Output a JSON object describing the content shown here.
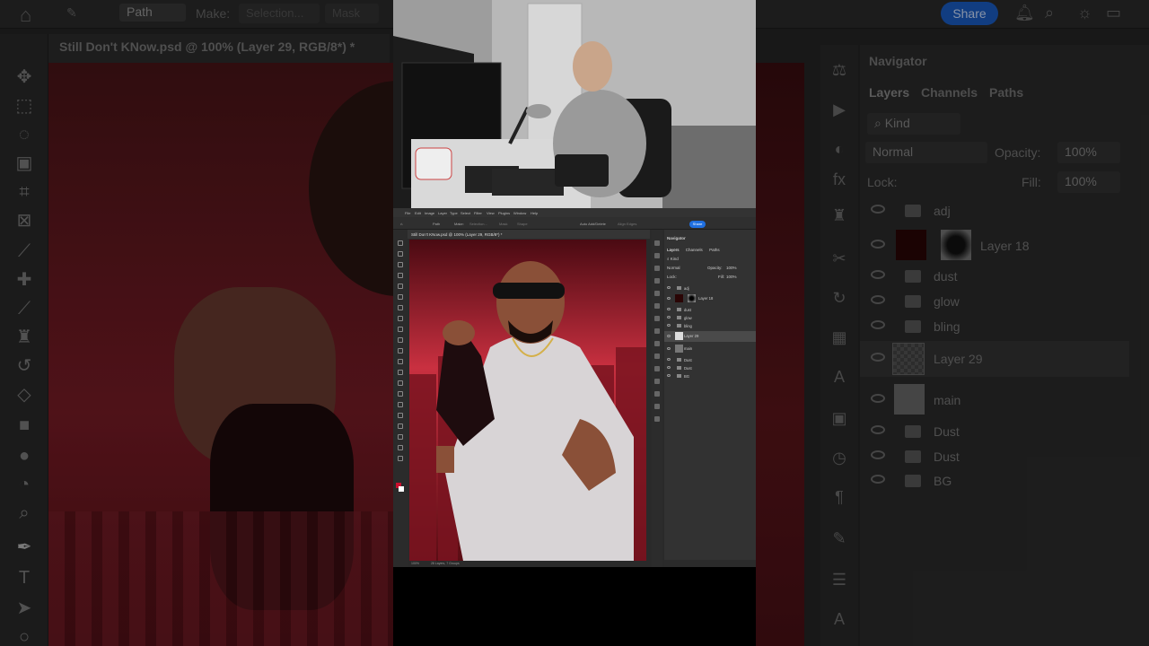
{
  "background_app": {
    "options_bar": {
      "path_mode": "Path",
      "make_label": "Make:",
      "selection_label": "Selection...",
      "mask_label": "Mask",
      "share_label": "Share"
    },
    "document_tab": "Still Don't KNow.psd @ 100% (Layer 29, RGB/8*) *",
    "panel": {
      "navigator_title": "Navigator",
      "tabs": [
        "Layers",
        "Channels",
        "Paths"
      ],
      "filter_kind": "Kind",
      "blend_mode": "Normal",
      "opacity_label": "Opacity:",
      "opacity_value": "100%",
      "lock_label": "Lock:",
      "fill_label": "Fill:",
      "fill_value": "100%",
      "layers": [
        {
          "name": "adj",
          "type": "group"
        },
        {
          "name": "Layer 18",
          "type": "layer-mask"
        },
        {
          "name": "dust",
          "type": "group"
        },
        {
          "name": "glow",
          "type": "group"
        },
        {
          "name": "bling",
          "type": "group"
        },
        {
          "name": "Layer 29",
          "type": "layer",
          "selected": true
        },
        {
          "name": "main",
          "type": "layer"
        },
        {
          "name": "Dust",
          "type": "group"
        },
        {
          "name": "Dust",
          "type": "group"
        },
        {
          "name": "BG",
          "type": "group"
        }
      ]
    }
  },
  "mini_app": {
    "menu": [
      "File",
      "Edit",
      "Image",
      "Layer",
      "Type",
      "Select",
      "Filter",
      "View",
      "Plugins",
      "Window",
      "Help"
    ],
    "options": [
      "Path",
      "Make:",
      "Selection...",
      "Mask",
      "Shape",
      "Auto Add/Delete",
      "Align Edges"
    ],
    "share_label": "Share",
    "document_tab": "Still Don't KNow.psd @ 100% (Layer 29, RGB/8*) *",
    "status_zoom": "100%",
    "status_info": "28 Layers, 7 Groups",
    "panel": {
      "navigator_title": "Navigator",
      "tabs": [
        "Layers",
        "Channels",
        "Paths"
      ],
      "filter_kind": "Kind",
      "blend_mode": "Normal",
      "opacity_label": "Opacity:",
      "opacity_value": "100%",
      "lock_label": "Lock:",
      "fill_label": "Fill:",
      "fill_value": "100%",
      "layers": [
        "adj",
        "Layer 18",
        "dust",
        "glow",
        "bling",
        "Layer 29",
        "main",
        "Dust",
        "Dust",
        "BG"
      ]
    }
  },
  "colors": {
    "accent_blue": "#1f6fe0",
    "poster_red": "#c22a3c",
    "ui_dark": "#2a2a2a"
  }
}
